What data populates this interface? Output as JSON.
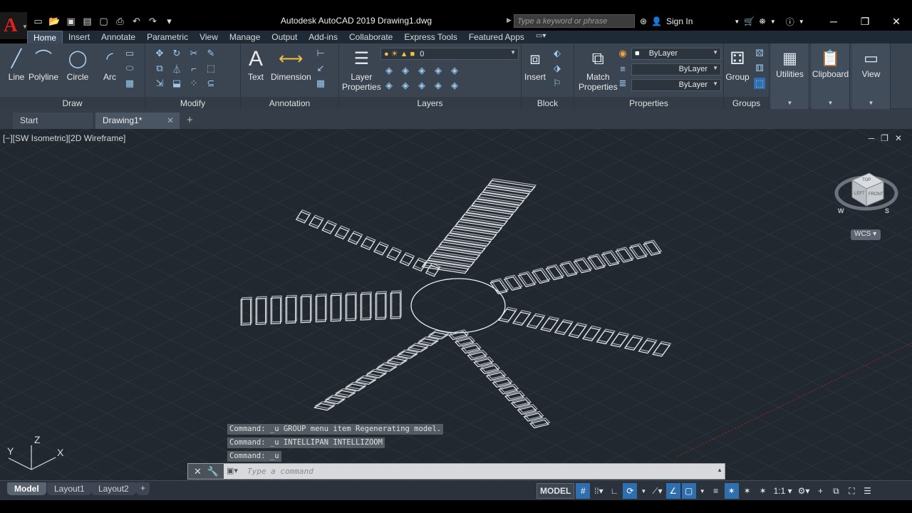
{
  "app": {
    "title": "Autodesk AutoCAD 2019    Drawing1.dwg",
    "search_placeholder": "Type a keyword or phrase",
    "sign_in": "Sign In"
  },
  "ribbon_tabs": [
    "Home",
    "Insert",
    "Annotate",
    "Parametric",
    "View",
    "Manage",
    "Output",
    "Add-ins",
    "Collaborate",
    "Express Tools",
    "Featured Apps"
  ],
  "panels": {
    "draw": {
      "title": "Draw",
      "line": "Line",
      "polyline": "Polyline",
      "circle": "Circle",
      "arc": "Arc"
    },
    "modify": {
      "title": "Modify"
    },
    "annotation": {
      "title": "Annotation",
      "text": "Text",
      "dimension": "Dimension"
    },
    "layers": {
      "title": "Layers",
      "layer_properties_1": "Layer",
      "layer_properties_2": "Properties",
      "current_layer": "0"
    },
    "block": {
      "title": "Block",
      "insert": "Insert"
    },
    "properties": {
      "title": "Properties",
      "match_1": "Match",
      "match_2": "Properties",
      "color": "ByLayer",
      "linetype": "ByLayer",
      "lineweight": "ByLayer"
    },
    "groups": {
      "title": "Groups",
      "group": "Group"
    },
    "utilities": "Utilities",
    "clipboard": "Clipboard",
    "view": "View"
  },
  "file_tabs": {
    "start": "Start",
    "doc": "Drawing1*"
  },
  "viewport": {
    "label": "[−][SW Isometric][2D Wireframe]",
    "wcs": "WCS",
    "ucs_axes": {
      "x": "X",
      "y": "Y",
      "z": "Z"
    },
    "viewcube": {
      "top": "TOP",
      "left": "LEFT",
      "front": "FRONT",
      "w": "W",
      "s": "S"
    }
  },
  "command": {
    "history": [
      "Command: _u GROUP menu item Regenerating model.",
      "Command: _u INTELLIPAN INTELLIZOOM",
      "Command: _u"
    ],
    "placeholder": "Type a command"
  },
  "status": {
    "layouts": [
      "Model",
      "Layout1",
      "Layout2"
    ],
    "model": "MODEL",
    "scale": "1:1"
  },
  "colors": {
    "canvas": "#212830",
    "ribbon": "#3b4552",
    "accent": "#2f6fb0",
    "geometry": "#e8ecf0"
  }
}
